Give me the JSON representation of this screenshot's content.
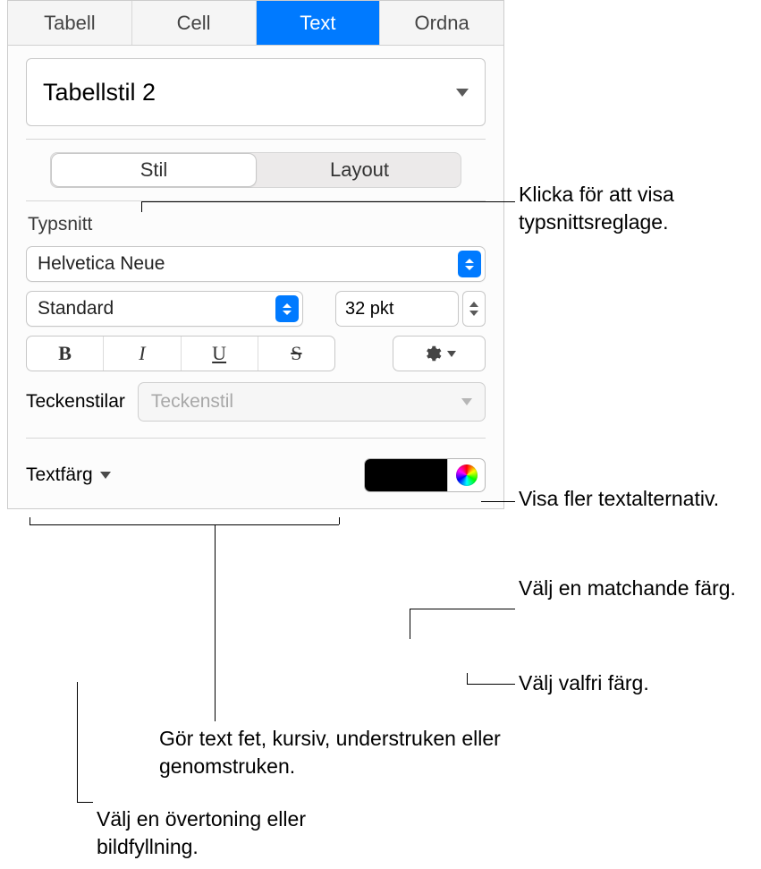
{
  "tabs": {
    "tabell": "Tabell",
    "cell": "Cell",
    "text": "Text",
    "ordna": "Ordna"
  },
  "paragraph_style": "Tabellstil 2",
  "subtabs": {
    "stil": "Stil",
    "layout": "Layout"
  },
  "font_section_label": "Typsnitt",
  "font_family": "Helvetica Neue",
  "font_weight": "Standard",
  "font_size": "32 pkt",
  "style_buttons": {
    "bold": "B",
    "italic": "I",
    "underline": "U",
    "strike": "S"
  },
  "charstyles_label": "Teckenstilar",
  "charstyles_placeholder": "Teckenstil",
  "textcolor_label": "Textfärg",
  "swatch_color": "#000000",
  "callouts": {
    "font_controls": "Klicka för att visa typsnittsreglage.",
    "more_options": "Visa fler textalternativ.",
    "match_color": "Välj en matchande färg.",
    "any_color": "Välj valfri färg.",
    "bius": "Gör text fet, kursiv, understruken eller genomstruken.",
    "gradient": "Välj en övertoning eller bildfyllning."
  }
}
